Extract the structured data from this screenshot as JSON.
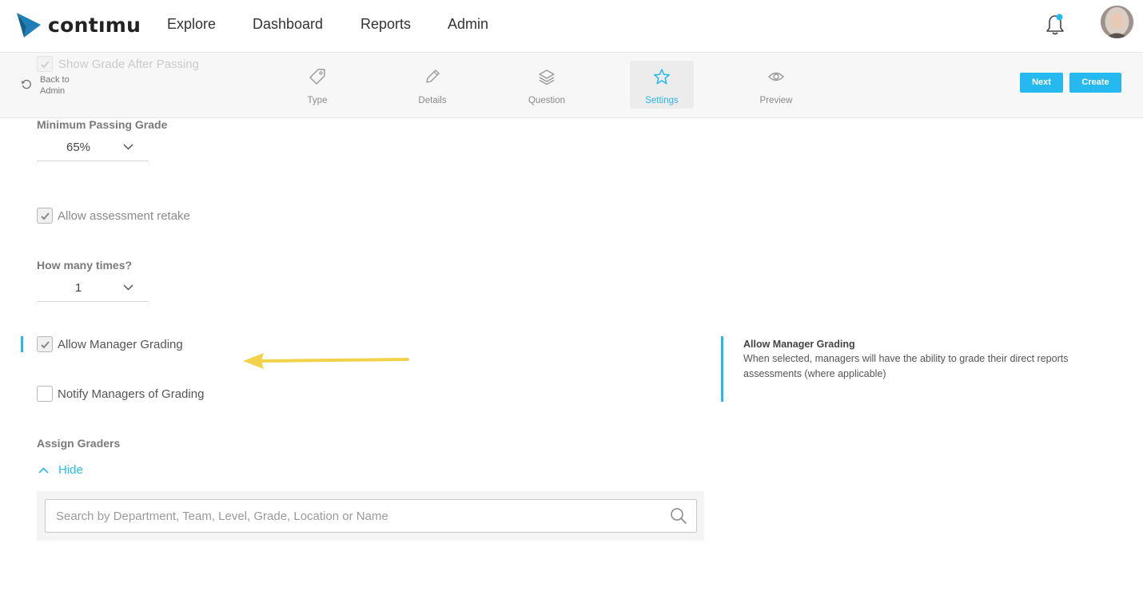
{
  "nav": {
    "brand": "contımu",
    "links": [
      "Explore",
      "Dashboard",
      "Reports",
      "Admin"
    ]
  },
  "wizard": {
    "back_label": "Back to Admin",
    "ghost_option": "Show Grade After Passing",
    "steps": [
      {
        "label": "Type",
        "icon": "tag-icon"
      },
      {
        "label": "Details",
        "icon": "pencil-icon"
      },
      {
        "label": "Question",
        "icon": "layers-icon"
      },
      {
        "label": "Settings",
        "icon": "star-icon",
        "active": true
      },
      {
        "label": "Preview",
        "icon": "eye-icon"
      }
    ],
    "next_label": "Next",
    "create_label": "Create"
  },
  "form": {
    "min_grade_label": "Minimum Passing Grade",
    "min_grade_value": "65%",
    "retake_label": "Allow assessment retake",
    "retake_checked": true,
    "times_label": "How many times?",
    "times_value": "1",
    "manager_grading_label": "Allow Manager Grading",
    "manager_grading_checked": true,
    "notify_label": "Notify Managers of Grading",
    "notify_checked": false,
    "assign_label": "Assign Graders",
    "hide_label": "Hide",
    "search_placeholder": "Search by Department, Team, Level, Grade, Location or Name"
  },
  "help": {
    "title": "Allow Manager Grading",
    "body": "When selected, managers will have the ability to grade their direct reports assessments (where applicable)"
  },
  "colors": {
    "accent": "#26b9ef",
    "annotation_arrow": "#f2d24b"
  }
}
